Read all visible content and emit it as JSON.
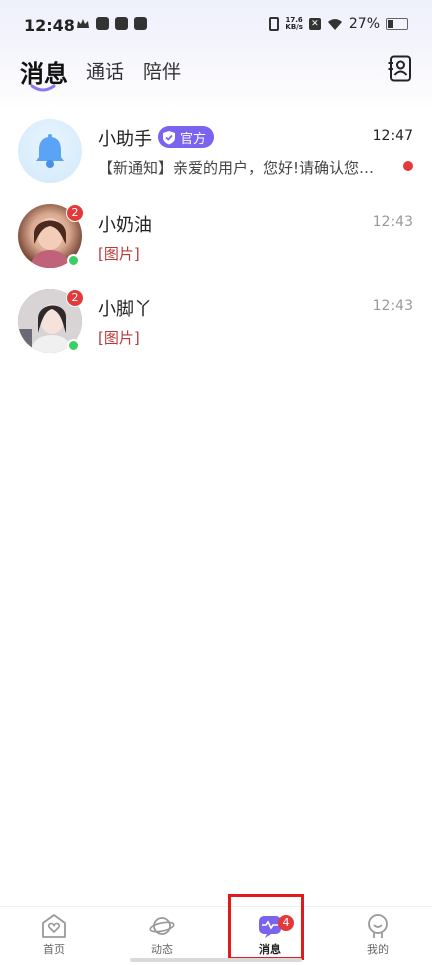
{
  "status_bar": {
    "time": "12:48",
    "net_speed": "17.6",
    "net_unit": "KB/s",
    "battery": "27%"
  },
  "header": {
    "tabs": [
      {
        "label": "消息"
      },
      {
        "label": "通话"
      },
      {
        "label": "陪伴"
      }
    ]
  },
  "conversations": [
    {
      "name": "小助手",
      "tag": "官方",
      "preview": "【新通知】亲爱的用户，您好!请确认您…",
      "time": "12:47",
      "unread_dot": true
    },
    {
      "name": "小奶油",
      "preview": "[图片]",
      "time": "12:43",
      "badge": "2",
      "online": true
    },
    {
      "name": "小脚丫",
      "preview": "[图片]",
      "time": "12:43",
      "badge": "2",
      "online": true
    }
  ],
  "bottom_nav": {
    "items": [
      {
        "label": "首页",
        "icon": "heart-home-icon"
      },
      {
        "label": "动态",
        "icon": "planet-icon"
      },
      {
        "label": "消息",
        "icon": "message-icon",
        "badge": "4",
        "active": true
      },
      {
        "label": "我的",
        "icon": "profile-icon"
      }
    ]
  },
  "colors": {
    "accent": "#7a63ee",
    "badge": "#e23a3a",
    "online": "#3bcf63",
    "highlight": "#e01b1b"
  }
}
